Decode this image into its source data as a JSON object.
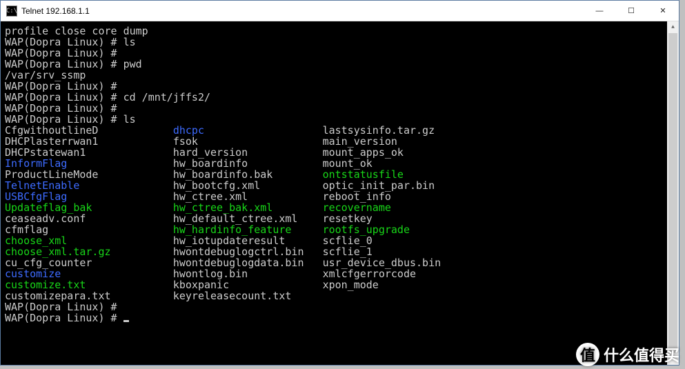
{
  "window": {
    "title": "Telnet 192.168.1.1",
    "icon_label": "C:\\",
    "min_label": "—",
    "max_label": "☐",
    "close_label": "✕"
  },
  "terminal": {
    "lines": [
      [
        {
          "t": "profile close core dump",
          "c": ""
        }
      ],
      [
        {
          "t": "WAP(Dopra Linux) # ls",
          "c": ""
        }
      ],
      [
        {
          "t": "WAP(Dopra Linux) #",
          "c": ""
        }
      ],
      [
        {
          "t": "WAP(Dopra Linux) # pwd",
          "c": ""
        }
      ],
      [
        {
          "t": "/var/srv_ssmp",
          "c": ""
        }
      ],
      [
        {
          "t": "WAP(Dopra Linux) #",
          "c": ""
        }
      ],
      [
        {
          "t": "WAP(Dopra Linux) # cd /mnt/jffs2/",
          "c": ""
        }
      ],
      [
        {
          "t": "WAP(Dopra Linux) #",
          "c": ""
        }
      ],
      [
        {
          "t": "WAP(Dopra Linux) # ls",
          "c": ""
        }
      ]
    ],
    "listing": [
      [
        {
          "t": "CfgwithoutlineD",
          "c": ""
        },
        {
          "t": "dhcpc",
          "c": "blue"
        },
        {
          "t": "lastsysinfo.tar.gz",
          "c": ""
        }
      ],
      [
        {
          "t": "DHCPlasterrwan1",
          "c": ""
        },
        {
          "t": "fsok",
          "c": ""
        },
        {
          "t": "main_version",
          "c": ""
        }
      ],
      [
        {
          "t": "DHCPstatewan1",
          "c": ""
        },
        {
          "t": "hard_version",
          "c": ""
        },
        {
          "t": "mount_apps_ok",
          "c": ""
        }
      ],
      [
        {
          "t": "InformFlag",
          "c": "blue"
        },
        {
          "t": "hw_boardinfo",
          "c": ""
        },
        {
          "t": "mount_ok",
          "c": ""
        }
      ],
      [
        {
          "t": "ProductLineMode",
          "c": ""
        },
        {
          "t": "hw_boardinfo.bak",
          "c": ""
        },
        {
          "t": "ontstatusfile",
          "c": "green"
        }
      ],
      [
        {
          "t": "TelnetEnable",
          "c": "blue"
        },
        {
          "t": "hw_bootcfg.xml",
          "c": ""
        },
        {
          "t": "optic_init_par.bin",
          "c": ""
        }
      ],
      [
        {
          "t": "USBCfgFlag",
          "c": "blue"
        },
        {
          "t": "hw_ctree.xml",
          "c": ""
        },
        {
          "t": "reboot_info",
          "c": ""
        }
      ],
      [
        {
          "t": "Updateflag_bak",
          "c": "green"
        },
        {
          "t": "hw_ctree_bak.xml",
          "c": "green"
        },
        {
          "t": "recovername",
          "c": "green"
        }
      ],
      [
        {
          "t": "ceaseadv.conf",
          "c": ""
        },
        {
          "t": "hw_default_ctree.xml",
          "c": ""
        },
        {
          "t": "resetkey",
          "c": ""
        }
      ],
      [
        {
          "t": "cfmflag",
          "c": ""
        },
        {
          "t": "hw_hardinfo_feature",
          "c": "green"
        },
        {
          "t": "rootfs_upgrade",
          "c": "green"
        }
      ],
      [
        {
          "t": "choose_xml",
          "c": "green"
        },
        {
          "t": "hw_iotupdateresult",
          "c": ""
        },
        {
          "t": "scflie_0",
          "c": ""
        }
      ],
      [
        {
          "t": "choose_xml.tar.gz",
          "c": "green"
        },
        {
          "t": "hwontdebuglogctrl.bin",
          "c": ""
        },
        {
          "t": "scflie_1",
          "c": ""
        }
      ],
      [
        {
          "t": "cu_cfg_counter",
          "c": ""
        },
        {
          "t": "hwontdebuglogdata.bin",
          "c": ""
        },
        {
          "t": "usr_device_dbus.bin",
          "c": ""
        }
      ],
      [
        {
          "t": "customize",
          "c": "blue"
        },
        {
          "t": "hwontlog.bin",
          "c": ""
        },
        {
          "t": "xmlcfgerrorcode",
          "c": ""
        }
      ],
      [
        {
          "t": "customize.txt",
          "c": "green"
        },
        {
          "t": "kboxpanic",
          "c": ""
        },
        {
          "t": "xpon_mode",
          "c": ""
        }
      ],
      [
        {
          "t": "customizepara.txt",
          "c": ""
        },
        {
          "t": "keyreleasecount.txt",
          "c": ""
        },
        {
          "t": "",
          "c": ""
        }
      ]
    ],
    "tail": [
      [
        {
          "t": "WAP(Dopra Linux) #",
          "c": ""
        }
      ],
      [
        {
          "t": "WAP(Dopra Linux) # ",
          "c": "",
          "cursor": true
        }
      ]
    ]
  },
  "watermark": {
    "badge": "值",
    "text": "什么值得买"
  }
}
